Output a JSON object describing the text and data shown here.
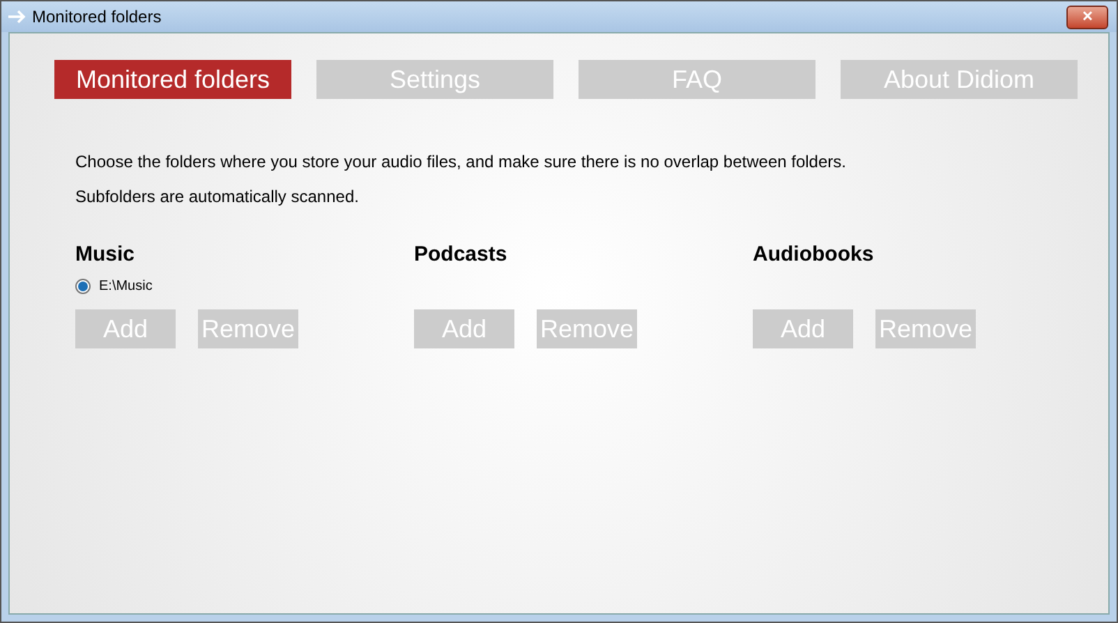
{
  "window": {
    "title": "Monitored folders",
    "close": "✕"
  },
  "tabs": [
    {
      "label": "Monitored folders",
      "selected": true
    },
    {
      "label": "Settings",
      "selected": false
    },
    {
      "label": "FAQ",
      "selected": false
    },
    {
      "label": "About Didiom",
      "selected": false
    }
  ],
  "description": [
    "Choose the folders where you store your audio files, and make sure there is no overlap between folders.",
    "Subfolders are automatically scanned."
  ],
  "sections": [
    {
      "title": "Music",
      "folders": [
        {
          "path": "E:\\Music",
          "selected": true
        }
      ],
      "buttons": [
        "Add",
        "Remove"
      ]
    },
    {
      "title": "Podcasts",
      "buttons": [
        "Add",
        "Remove"
      ]
    },
    {
      "title": "Audiobooks",
      "buttons": [
        "Add",
        "Remove"
      ]
    }
  ]
}
